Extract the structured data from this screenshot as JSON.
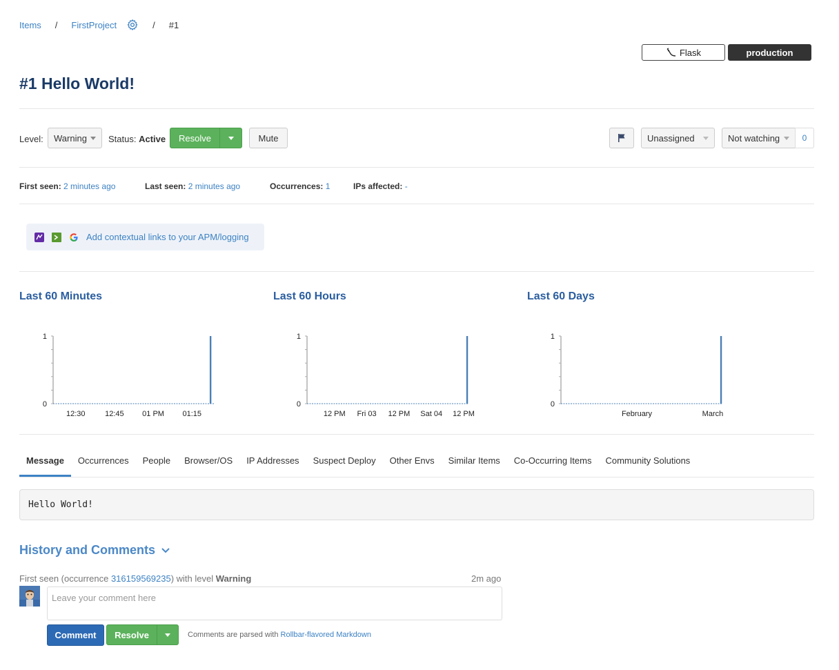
{
  "breadcrumb": {
    "items_label": "Items",
    "sep1": "/",
    "project_label": "FirstProject",
    "sep2": "/",
    "item_label": "#1"
  },
  "header": {
    "framework_label": "Flask",
    "environment_label": "production",
    "title": "#1 Hello World!"
  },
  "controls": {
    "level_label": "Level:",
    "level_value": "Warning",
    "status_label": "Status:",
    "status_value": "Active",
    "resolve_label": "Resolve",
    "mute_label": "Mute",
    "assignee_value": "Unassigned",
    "watch_value": "Not watching",
    "watch_count": "0"
  },
  "stats": {
    "first_seen_label": "First seen:",
    "first_seen_value": "2 minutes ago",
    "last_seen_label": "Last seen:",
    "last_seen_value": "2 minutes ago",
    "occurrences_label": "Occurrences:",
    "occurrences_value": "1",
    "ips_label": "IPs affected:",
    "ips_value": "-"
  },
  "apm": {
    "link_label": "Add contextual links to your APM/logging"
  },
  "chart_data": [
    {
      "type": "bar",
      "title": "Last 60 Minutes",
      "x_tick_labels": [
        "12:30",
        "12:45",
        "01 PM",
        "01:15"
      ],
      "y_tick_labels": [
        "0",
        "1"
      ],
      "ylim": [
        0,
        1
      ],
      "values": [
        0,
        0,
        0,
        0,
        0,
        0,
        0,
        0,
        0,
        0,
        0,
        0,
        0,
        0,
        0,
        0,
        0,
        0,
        0,
        0,
        0,
        0,
        0,
        0,
        0,
        0,
        0,
        0,
        0,
        0,
        0,
        0,
        0,
        0,
        0,
        0,
        0,
        0,
        0,
        0,
        0,
        0,
        0,
        0,
        0,
        0,
        0,
        0,
        0,
        0,
        0,
        0,
        0,
        0,
        0,
        0,
        0,
        0,
        1,
        0
      ],
      "color": "#4a7fb5"
    },
    {
      "type": "bar",
      "title": "Last 60 Hours",
      "x_tick_labels": [
        "12 PM",
        "Fri 03",
        "12 PM",
        "Sat 04",
        "12 PM"
      ],
      "y_tick_labels": [
        "0",
        "1"
      ],
      "ylim": [
        0,
        1
      ],
      "values": [
        0,
        0,
        0,
        0,
        0,
        0,
        0,
        0,
        0,
        0,
        0,
        0,
        0,
        0,
        0,
        0,
        0,
        0,
        0,
        0,
        0,
        0,
        0,
        0,
        0,
        0,
        0,
        0,
        0,
        0,
        0,
        0,
        0,
        0,
        0,
        0,
        0,
        0,
        0,
        0,
        0,
        0,
        0,
        0,
        0,
        0,
        0,
        0,
        0,
        0,
        0,
        0,
        0,
        0,
        0,
        0,
        0,
        0,
        0,
        1
      ],
      "color": "#4a7fb5"
    },
    {
      "type": "bar",
      "title": "Last 60 Days",
      "x_tick_labels": [
        "February",
        "March"
      ],
      "y_tick_labels": [
        "0",
        "1"
      ],
      "ylim": [
        0,
        1
      ],
      "values": [
        0,
        0,
        0,
        0,
        0,
        0,
        0,
        0,
        0,
        0,
        0,
        0,
        0,
        0,
        0,
        0,
        0,
        0,
        0,
        0,
        0,
        0,
        0,
        0,
        0,
        0,
        0,
        0,
        0,
        0,
        0,
        0,
        0,
        0,
        0,
        0,
        0,
        0,
        0,
        0,
        0,
        0,
        0,
        0,
        0,
        0,
        0,
        0,
        0,
        0,
        0,
        0,
        0,
        0,
        0,
        0,
        0,
        0,
        0,
        1
      ],
      "color": "#4a7fb5"
    }
  ],
  "tabs": [
    "Message",
    "Occurrences",
    "People",
    "Browser/OS",
    "IP Addresses",
    "Suspect Deploy",
    "Other Envs",
    "Similar Items",
    "Co-Occurring Items",
    "Community Solutions"
  ],
  "message": "Hello World!",
  "history": {
    "title": "History and Comments",
    "first_seen_prefix": "First seen (occurrence",
    "occurrence_id": "316159569235",
    "first_seen_mid": ") with level",
    "first_seen_level": "Warning",
    "time_ago": "2m ago",
    "comment_placeholder": "Leave your comment here",
    "comment_button": "Comment",
    "resolve_button": "Resolve",
    "markdown_note": "Comments are parsed with",
    "markdown_link": "Rollbar-flavored Markdown"
  },
  "colors": {
    "accent": "#3d82c4",
    "title": "#1a3a66",
    "chart_title": "#2a5d9f",
    "resolve_green": "#5cb25c",
    "comment_blue": "#2d6ab5"
  }
}
